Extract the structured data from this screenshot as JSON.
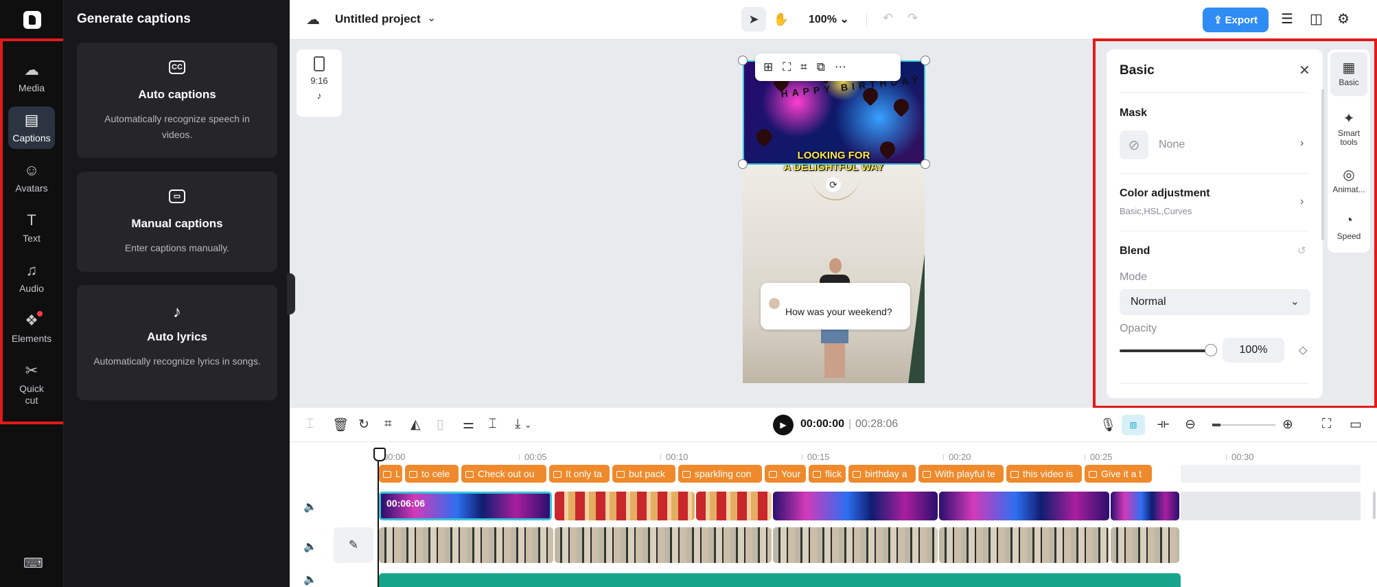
{
  "rail": {
    "items": [
      {
        "label": "Media",
        "icon": "cloud-upload-icon"
      },
      {
        "label": "Captions",
        "icon": "captions-icon"
      },
      {
        "label": "Avatars",
        "icon": "avatar-icon"
      },
      {
        "label": "Text",
        "icon": "text-icon"
      },
      {
        "label": "Audio",
        "icon": "music-note-icon"
      },
      {
        "label": "Elements",
        "icon": "elements-icon"
      },
      {
        "label": "Quick cut",
        "icon": "quick-cut-icon"
      }
    ],
    "active": "Captions",
    "glyphs": {
      "media": "☁",
      "captions": "▤",
      "avatars": "☺",
      "text": "T",
      "audio": "♫",
      "elements": "❖",
      "quickcut": "✂",
      "keyboard": "⌨"
    }
  },
  "panel": {
    "title": "Generate captions",
    "cards": [
      {
        "title": "Auto captions",
        "desc": "Automatically recognize speech in videos.",
        "icon": "cc-icon",
        "glyph": "CC"
      },
      {
        "title": "Manual captions",
        "desc": "Enter captions manually.",
        "icon": "keyboard-caption-icon",
        "glyph": "▭"
      },
      {
        "title": "Auto lyrics",
        "desc": "Automatically recognize lyrics in songs.",
        "icon": "lyrics-icon",
        "glyph": "♪"
      }
    ]
  },
  "topbar": {
    "project_name": "Untitled project",
    "zoom": "100%",
    "export_label": "Export",
    "glyphs": {
      "cloud": "☁",
      "chevron": "⌄",
      "pointer": "➤",
      "hand": "✋",
      "undo": "↶",
      "redo": "↷",
      "layers": "☰",
      "layout": "◫",
      "settings": "⚙",
      "export": "⇪"
    }
  },
  "canvas": {
    "ratio": "9:16",
    "video_caption_line1": "LOOKING FOR",
    "video_caption_line2": "A DELIGHTFUL WAY",
    "banner_text": "HAPPY BIRTHDAY",
    "chat_text": "How was your weekend?",
    "glyphs": {
      "tiktok": "♪",
      "rotate": "⟳",
      "add_media": "⊞",
      "fit": "⛶",
      "crop": "⌗",
      "replace": "⧉",
      "more": "⋯"
    }
  },
  "properties": {
    "title": "Basic",
    "mask_label": "Mask",
    "mask_value": "None",
    "color_adjust_label": "Color adjustment",
    "color_adjust_sub": "Basic,HSL,Curves",
    "blend_label": "Blend",
    "mode_label": "Mode",
    "mode_value": "Normal",
    "opacity_label": "Opacity",
    "opacity_value": "100%",
    "opacity_fraction": 1.0,
    "glyphs": {
      "close": "✕",
      "chevron_right": "›",
      "chevron_down": "⌄",
      "reset": "↺",
      "keyframe": "◇",
      "none": "⊘"
    }
  },
  "side_tabs": [
    {
      "label": "Basic",
      "icon": "film-icon",
      "glyph": "▦"
    },
    {
      "label": "Smart tools",
      "icon": "magic-wand-icon",
      "glyph": "✦"
    },
    {
      "label": "Animat...",
      "icon": "animation-icon",
      "glyph": "◎"
    },
    {
      "label": "Speed",
      "icon": "speedometer-icon",
      "glyph": "◔"
    }
  ],
  "timeline": {
    "current_time": "00:00:00",
    "separator": "|",
    "total_time": "00:28:06",
    "ruler": [
      "00:00",
      "00:05",
      "00:10",
      "00:15",
      "00:20",
      "00:25",
      "00:30"
    ],
    "caption_clips": [
      "L",
      "to cele",
      "Check out ou",
      "It only ta",
      "but pack",
      "sparkling con",
      "Your",
      "flick",
      "birthday a",
      "With playful te",
      "this video is",
      "Give it a t"
    ],
    "selected_clip_time": "00:06:06",
    "glyphs": {
      "split": "⌶",
      "delete": "🗑",
      "loop": "↻",
      "crop": "⌗",
      "mirror": "◭",
      "freeze": "▯",
      "adjust": "⚌",
      "cut": "⌶",
      "download": "⤓",
      "mic": "🎙",
      "snap": "⧈",
      "link": "⟛",
      "minus": "⊖",
      "plus": "⊕",
      "fullscreen": "⛶",
      "comment": "▭",
      "speaker": "🔈",
      "edit": "✎",
      "play": "▶"
    }
  }
}
